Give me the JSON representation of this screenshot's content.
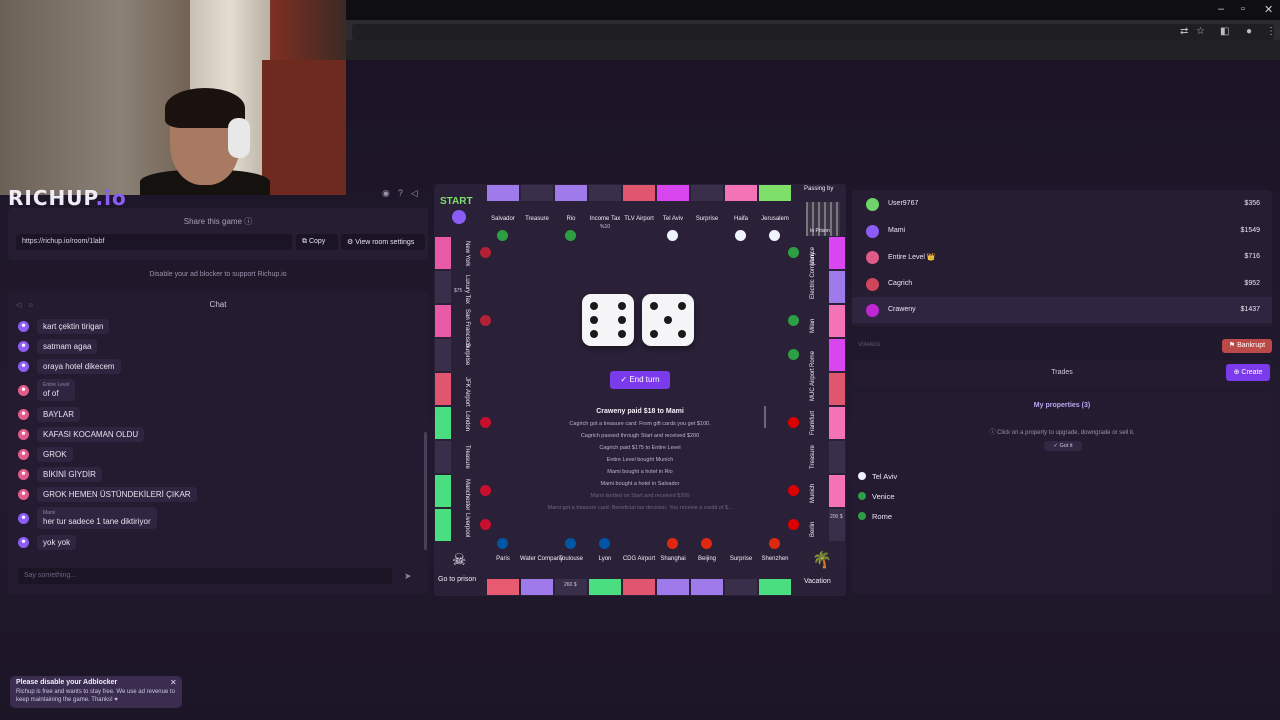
{
  "browser": {
    "minimize": "–",
    "maximize": "▫",
    "close": "✕"
  },
  "logo": {
    "name": "RICHUP",
    "tld": ".io"
  },
  "share": {
    "title": "Share this game ⓘ",
    "url": "https://richup.io/room/1labf",
    "copy_label": "⧉ Copy",
    "settings_label": "⚙ View room settings"
  },
  "adblock_strip": "Disable your ad blocker to support Richup.io",
  "chat": {
    "title": "Chat",
    "placeholder": "Say something...",
    "messages": [
      {
        "author": "",
        "text": "kart çektin tirigan",
        "color": "#8b5cf6"
      },
      {
        "author": "",
        "text": "satmam agaa",
        "color": "#8b5cf6"
      },
      {
        "author": "",
        "text": "oraya hotel dikecem",
        "color": "#8b5cf6"
      },
      {
        "author": "Entire Level",
        "text": "of of",
        "color": "#e05a8a"
      },
      {
        "author": "",
        "text": "BAYLAR",
        "color": "#e05a8a"
      },
      {
        "author": "",
        "text": "KAFASI KOCAMAN OLDU",
        "color": "#e05a8a"
      },
      {
        "author": "",
        "text": "GROK",
        "color": "#e05a8a"
      },
      {
        "author": "",
        "text": "BİKİNİ GİYDİR",
        "color": "#e05a8a"
      },
      {
        "author": "",
        "text": "GROK HEMEN ÜSTÜNDEKİLERİ ÇIKAR",
        "color": "#e05a8a"
      },
      {
        "author": "Mami",
        "text": "her tur sadece 1 tane diktiriyor",
        "color": "#8b5cf6"
      },
      {
        "author": "",
        "text": "yok yok",
        "color": "#8b5cf6"
      }
    ]
  },
  "ad_toast": {
    "title": "Please disable your Adblocker",
    "text": "Richup is free and wants to stay free. We use ad revenue to keep maintaining the game. Thanks! ♥",
    "close": "✕"
  },
  "board": {
    "corners": {
      "start": "START",
      "prison": "In Prison",
      "passing": "Passing by",
      "go_to_prison": "Go to prison",
      "vacation": "Vacation"
    },
    "top": [
      {
        "name": "Salvador",
        "color": "#9f7aea",
        "flag": "#2e9e44"
      },
      {
        "name": "Treasure",
        "color": "#3a2f4a",
        "flag": ""
      },
      {
        "name": "Rio",
        "color": "#9f7aea",
        "flag": "#2e9e44"
      },
      {
        "name": "Income Tax",
        "color": "#3a2f4a",
        "flag": ""
      },
      {
        "name": "TLV Airport",
        "color": "#e0566f",
        "flag": ""
      },
      {
        "name": "Tel Aviv",
        "color": "#d946ef",
        "flag": "#eef3ff"
      },
      {
        "name": "Surprise",
        "color": "#3a2f4a",
        "flag": ""
      },
      {
        "name": "Haifa",
        "color": "#f472b6",
        "flag": "#eef3ff"
      },
      {
        "name": "Jerusalem",
        "color": "#7ee06a",
        "flag": "#eef3ff"
      }
    ],
    "left": [
      {
        "name": "New York",
        "color": "#e85aa5",
        "flag": "#b22234"
      },
      {
        "name": "Luxury Tax",
        "color": "#3a2f4a",
        "flag": ""
      },
      {
        "name": "San Francisco",
        "color": "#e85aa5",
        "flag": "#b22234"
      },
      {
        "name": "Surprise",
        "color": "#3a2f4a",
        "flag": ""
      },
      {
        "name": "JFK Airport",
        "color": "#e0566f",
        "flag": ""
      },
      {
        "name": "London",
        "color": "#4ade80",
        "flag": "#c8102e"
      },
      {
        "name": "Treasure",
        "color": "#3a2f4a",
        "flag": ""
      },
      {
        "name": "Manchester",
        "color": "#4ade80",
        "flag": "#c8102e"
      },
      {
        "name": "Liverpool",
        "color": "#4ade80",
        "flag": "#c8102e"
      }
    ],
    "right": [
      {
        "name": "Venice",
        "color": "#d946ef",
        "flag": "#2e9e44"
      },
      {
        "name": "Electric Company",
        "color": "#9f7aea",
        "flag": ""
      },
      {
        "name": "Milan",
        "color": "#f472b6",
        "flag": "#2e9e44"
      },
      {
        "name": "Rome",
        "color": "#d946ef",
        "flag": "#2e9e44"
      },
      {
        "name": "MUC Airport",
        "color": "#e0566f",
        "flag": ""
      },
      {
        "name": "Frankfurt",
        "color": "#f472b6",
        "flag": "#dd0000"
      },
      {
        "name": "Treasure",
        "color": "#3a2f4a",
        "flag": ""
      },
      {
        "name": "Munich",
        "color": "#f472b6",
        "flag": "#dd0000"
      },
      {
        "name": "Berlin",
        "color": "#3a2f4a",
        "flag": "#dd0000"
      }
    ],
    "bottom": [
      {
        "name": "Paris",
        "color": "#e85a70",
        "flag": "#0055a4"
      },
      {
        "name": "Water Company",
        "color": "#9f7aea",
        "flag": ""
      },
      {
        "name": "Toulouse",
        "color": "#3a2f4a",
        "flag": "#0055a4"
      },
      {
        "name": "Lyon",
        "color": "#4ade80",
        "flag": "#0055a4"
      },
      {
        "name": "CDG Airport",
        "color": "#e0566f",
        "flag": ""
      },
      {
        "name": "Shanghai",
        "color": "#9f7aea",
        "flag": "#de2910"
      },
      {
        "name": "Beijing",
        "color": "#9f7aea",
        "flag": "#de2910"
      },
      {
        "name": "Surprise",
        "color": "#3a2f4a",
        "flag": ""
      },
      {
        "name": "Shenzhen",
        "color": "#4ade80",
        "flag": "#de2910"
      }
    ],
    "prices": {
      "income_tax": "%10",
      "luxury_tax": "$75",
      "toulouse": "260 $",
      "berlin": "200 $"
    },
    "end_turn": "✓ End turn",
    "log": [
      "Crawenу  paid $18 to  Mami",
      "Cagrich  got a treasure card: From gift cards you get $100.",
      "Cagrich  passed through Start and received $200",
      "Cagrich  paid $175 to  Entire Level",
      "Entire Level  bought  Munich",
      "Mami  bought a hotel in  Rio",
      "Mami  bought a hotel in  Salvador",
      "Mami  landed on Start and received $300",
      "Mami  got a treasure card: Beneficial tax decision. You receive a credit of $..."
    ]
  },
  "players": [
    {
      "name": "User9767",
      "money": "$356",
      "color": "#6dd36a",
      "active": false
    },
    {
      "name": "Mami",
      "money": "$1549",
      "color": "#8b5cf6",
      "active": false
    },
    {
      "name": "Entire Level 👑",
      "money": "$716",
      "color": "#e05a8a",
      "active": false
    },
    {
      "name": "Cagrich",
      "money": "$952",
      "color": "#d0455a",
      "active": false
    },
    {
      "name": "Crawenу",
      "money": "$1437",
      "color": "#c026d3",
      "active": true
    }
  ],
  "votekick": "Votekick",
  "bankrupt": "⚑ Bankrupt",
  "trades": {
    "title": "Trades",
    "create": "⊕ Create"
  },
  "my_properties": {
    "title": "My properties (3)",
    "hint": "ⓘ Click on a property to upgrade, downgrade or sell it.",
    "got_it": "✓ Got it",
    "items": [
      {
        "name": "Tel Aviv",
        "flag": "#eef3ff"
      },
      {
        "name": "Venice",
        "flag": "#2e9e44"
      },
      {
        "name": "Rome",
        "flag": "#2e9e44"
      }
    ]
  }
}
